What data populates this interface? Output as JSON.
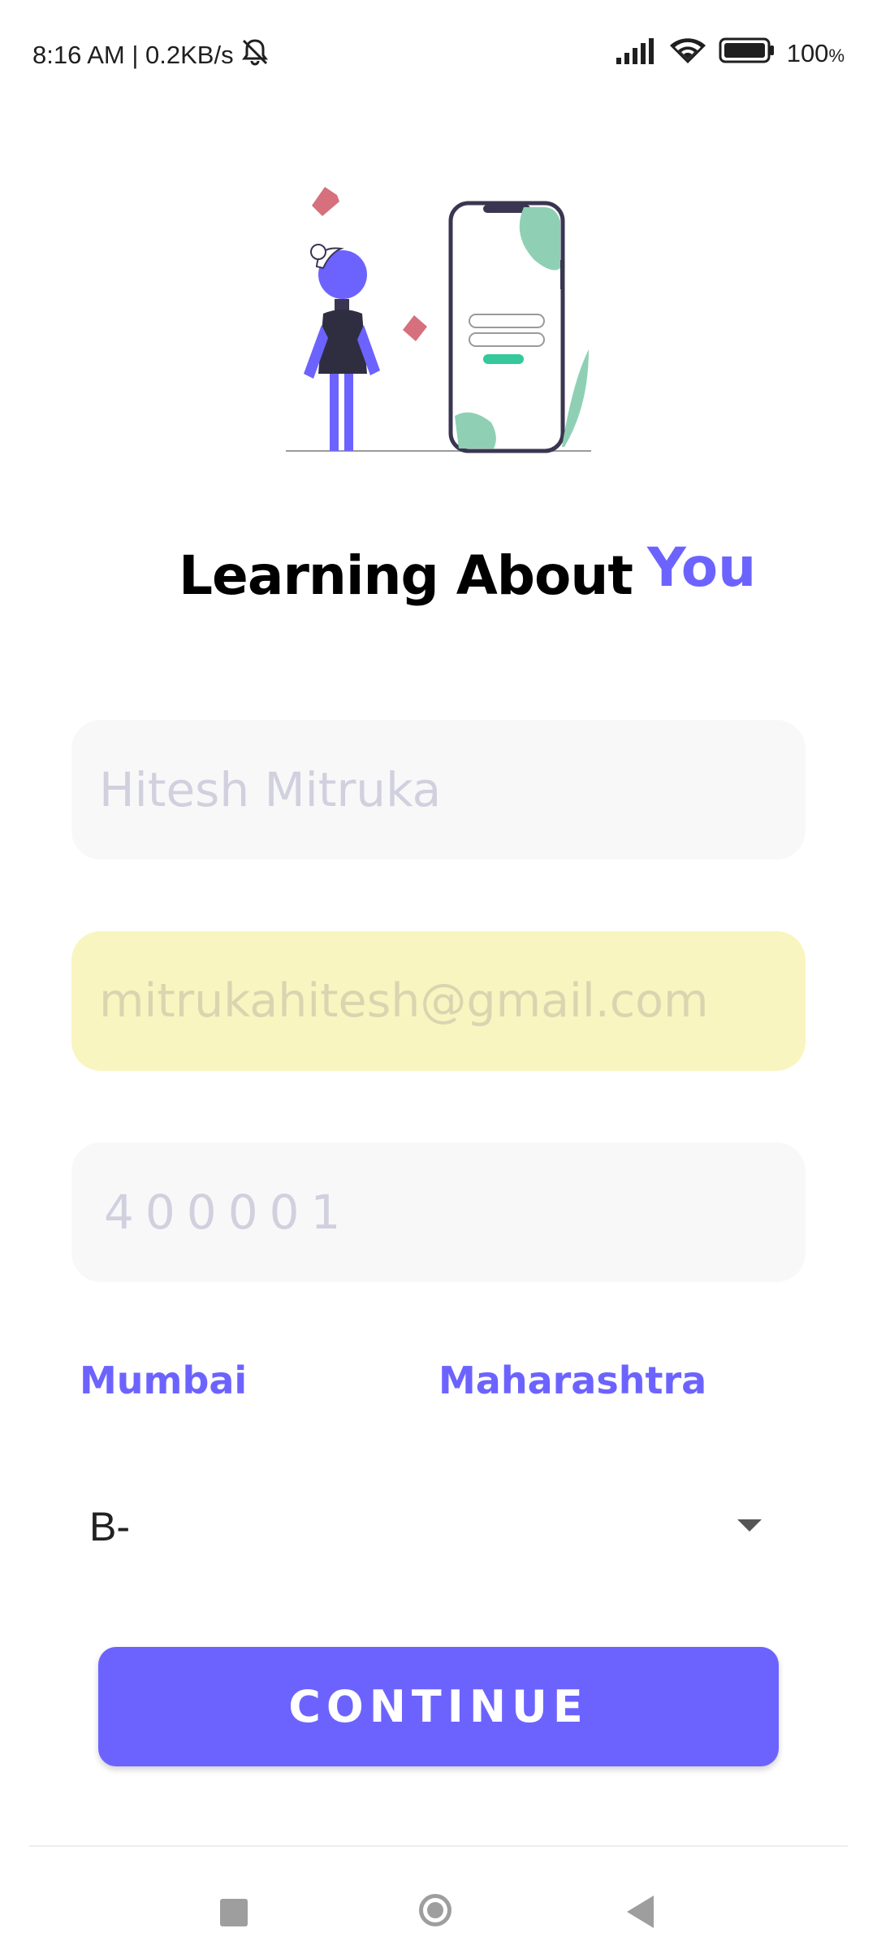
{
  "status_bar": {
    "time_speed": "8:16 AM | 0.2KB/s",
    "battery": "100",
    "battery_unit": "%",
    "icons": [
      "mute-bell-icon",
      "signal-icon",
      "wifi-icon",
      "battery-icon"
    ]
  },
  "headline": {
    "prefix": "Learning About",
    "highlight": "You",
    "highlight_color": "#6c63ff"
  },
  "form": {
    "name_value": "Hitesh Mitruka",
    "email_value": "mitrukahitesh@gmail.com",
    "pincode_value": "400001",
    "city": "Mumbai",
    "state": "Maharashtra",
    "blood_group_selected": "B-"
  },
  "actions": {
    "continue_label": "CONTINUE"
  },
  "colors": {
    "accent": "#6c63ff",
    "field_bg": "#f8f8f9",
    "autofill_bg": "#f9f5c0"
  },
  "nav": {
    "icons": [
      "recents-square-icon",
      "home-circle-icon",
      "back-triangle-icon"
    ]
  }
}
